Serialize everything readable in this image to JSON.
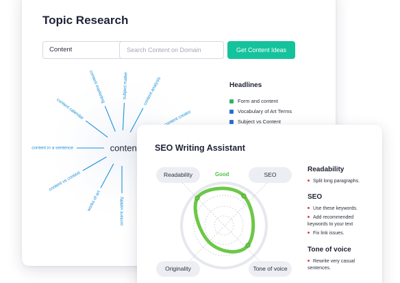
{
  "topic_research": {
    "title": "Topic Research",
    "search_value": "Content",
    "clear_label": "x",
    "domain_placeholder": "Search Content on Domain",
    "button_label": "Get Content Ideas",
    "center_word": "content",
    "spokes": [
      "content marketing",
      "subject matter",
      "content analysis",
      "content calendar",
      "content creator",
      "content in a sentence",
      "content vs context",
      "works of art",
      "content validity"
    ],
    "headlines_title": "Headlines",
    "headlines": [
      {
        "icon": "green-square-icon",
        "text": "Form and content"
      },
      {
        "icon": "blue-square-icon",
        "text": "Vocabulary of Art Terms"
      },
      {
        "icon": "blue-square-icon",
        "text": "Subject vs Content"
      }
    ]
  },
  "seo_writing_assistant": {
    "title": "SEO Writing Assistant",
    "score_label": "Good",
    "axes": {
      "readability": "Readability",
      "seo": "SEO",
      "originality": "Originality",
      "tone": "Tone of voice"
    },
    "sections": [
      {
        "title": "Readability",
        "items": [
          "Split long paragraphs."
        ]
      },
      {
        "title": "SEO",
        "items": [
          "Use these keywords.",
          "Add recommended keywords to your text",
          "Fix link issues."
        ]
      },
      {
        "title": "Tone of voice",
        "items": [
          "Rewrite very casual sentences."
        ]
      }
    ],
    "colors": {
      "accent_green": "#6cc846",
      "bullet_red": "#e23b4b"
    }
  },
  "colors": {
    "primary_button": "#14c39b",
    "spoke_text": "#1a8fd8"
  }
}
